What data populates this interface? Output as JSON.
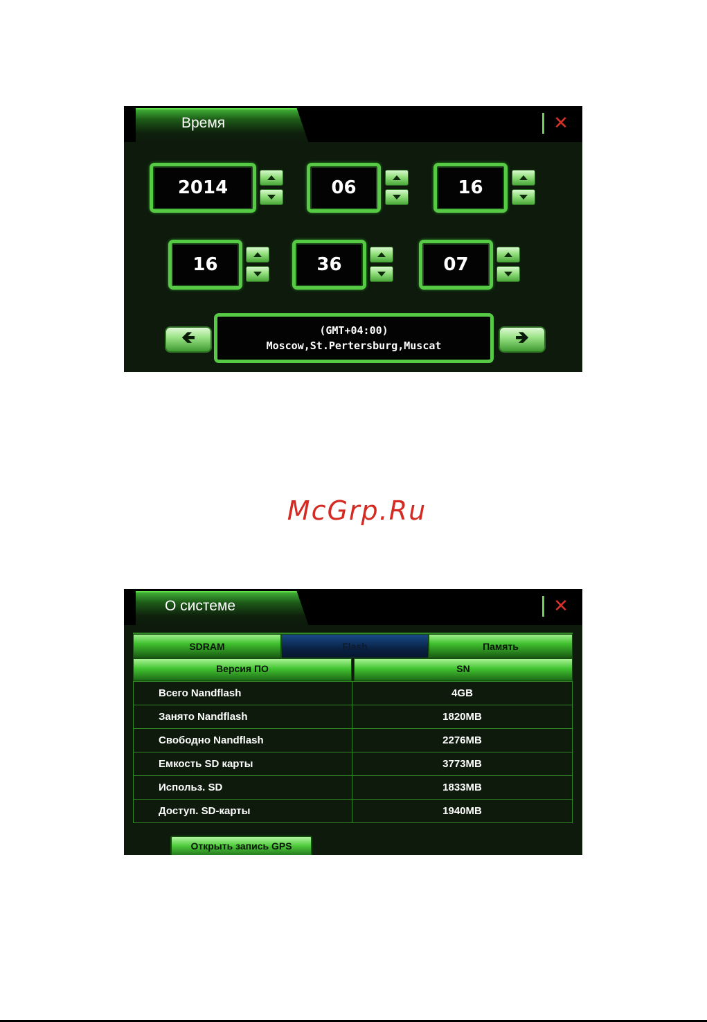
{
  "time_screen": {
    "title": "Время",
    "close_symbol": "✕",
    "date": {
      "year": "2014",
      "month": "06",
      "day": "16"
    },
    "time": {
      "hour": "16",
      "minute": "36",
      "second": "07"
    },
    "timezone": {
      "offset": "(GMT+04:00)",
      "cities": "Moscow,St.Pertersburg,Muscat"
    },
    "prev_arrow": "🡸",
    "next_arrow": "🡺"
  },
  "watermark": "McGrp.Ru",
  "system_screen": {
    "title": "О системе",
    "close_symbol": "✕",
    "tabs": [
      "SDRAM",
      "Flash",
      "Память"
    ],
    "active_tab": "Flash",
    "subheaders": [
      "Версия ПО",
      "SN"
    ],
    "rows": [
      {
        "label": "Всего Nandflash",
        "value": "4GB"
      },
      {
        "label": "Занято Nandflash",
        "value": "1820MB"
      },
      {
        "label": "Свободно Nandflash",
        "value": "2276MB"
      },
      {
        "label": "Емкость SD карты",
        "value": "3773MB"
      },
      {
        "label": "Использ. SD",
        "value": "1833MB"
      },
      {
        "label": "Доступ. SD-карты",
        "value": "1940MB"
      }
    ],
    "gps_button": "Открыть запись GPS"
  },
  "colors": {
    "accent_green": "#56c945",
    "close_red": "#d8322a",
    "watermark_red": "#d42a22",
    "background_dark": "#0d1a0c"
  }
}
